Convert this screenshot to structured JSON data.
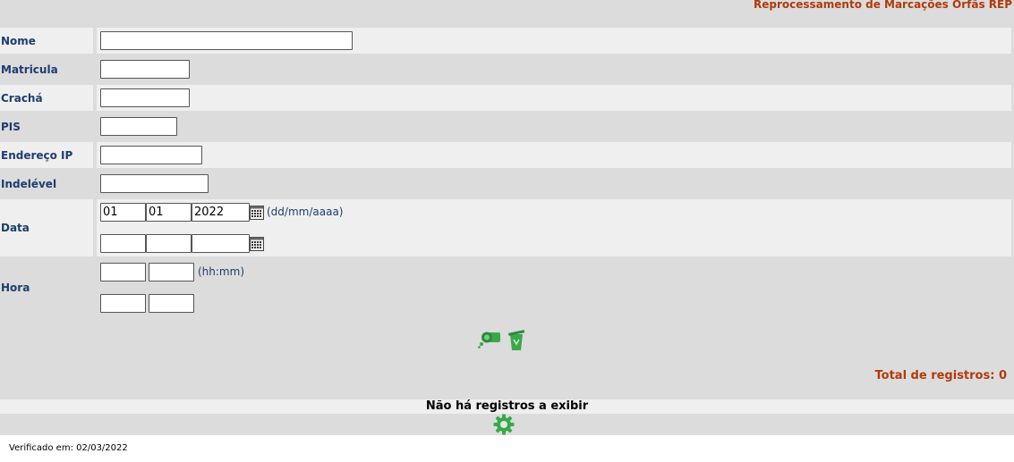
{
  "page_title": "Reprocessamento de Marcações Orfãs REP",
  "fields": {
    "nome": {
      "label": "Nome",
      "value": ""
    },
    "matricula": {
      "label": "Matricula",
      "value": ""
    },
    "cracha": {
      "label": "Crachá",
      "value": ""
    },
    "pis": {
      "label": "PIS",
      "value": ""
    },
    "endereco_ip": {
      "label": "Endereço IP",
      "value": ""
    },
    "indelevel": {
      "label": "Indelével",
      "value": ""
    },
    "data": {
      "label": "Data",
      "hint": "(dd/mm/aaaa)",
      "start": {
        "day": "01",
        "month": "01",
        "year": "2022"
      },
      "end": {
        "day": "",
        "month": "",
        "year": ""
      }
    },
    "hora": {
      "label": "Hora",
      "hint": "(hh:mm)",
      "start": {
        "hh": "",
        "mm": ""
      },
      "end": {
        "hh": "",
        "mm": ""
      }
    }
  },
  "actions": {
    "search_icon": "search-icon",
    "clear_icon": "trash-icon"
  },
  "results": {
    "total_label": "Total de registros: 0",
    "empty_message": "Não há registros a exibir",
    "process_icon": "gear-icon"
  },
  "footer": {
    "verified": "Verificado em: 02/03/2022"
  },
  "colors": {
    "accent_red": "#b03a0a",
    "label_blue": "#1d3d6e",
    "icon_green": "#3aa84a"
  }
}
